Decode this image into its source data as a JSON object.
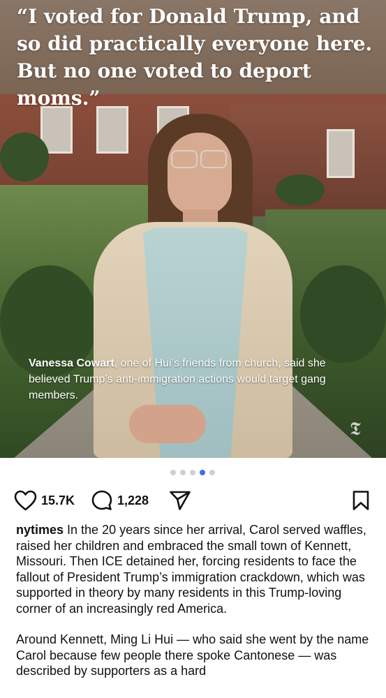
{
  "slide": {
    "headline": "“I voted for Donald Trump, and so did practically everyone here. But no one voted to deport moms.”",
    "caption_name": "Vanessa Cowart",
    "caption_text": ", one of Hui’s friends from church, said she believed Trump’s anti-immigration actions would target gang members.",
    "watermark_icon": "nyt-t-logo-icon"
  },
  "carousel": {
    "total": 5,
    "active_index": 3,
    "active_color": "#3f6ef0",
    "inactive_color": "#d0d0d0"
  },
  "actions": {
    "likes": "15.7K",
    "comments": "1,228",
    "icons": [
      "heart-icon",
      "comment-icon",
      "share-icon",
      "bookmark-icon"
    ]
  },
  "post": {
    "username": "nytimes",
    "paragraph1": " In the 20 years since her arrival, Carol served waffles, raised her children and embraced the small town of Kennett, Missouri. Then ICE detained her, forcing residents to face the fallout of President Trump’s immigration crackdown, which was supported in theory by many residents in this Trump-loving corner of an increasingly red America.",
    "paragraph2": "Around Kennett, Ming Li Hui — who said she went by the name Carol because few people there spoke Cantonese — was described by supporters as a hard"
  }
}
